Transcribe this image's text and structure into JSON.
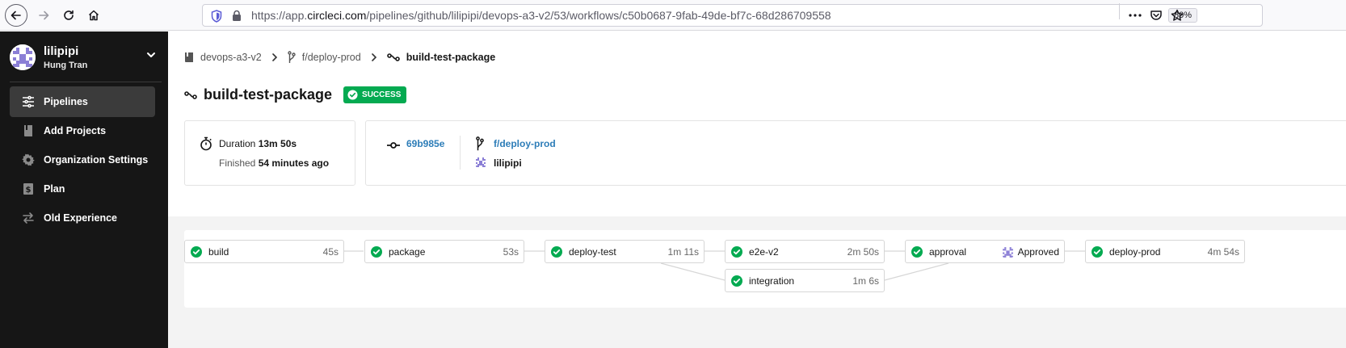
{
  "browser": {
    "url_prefix": "https://app.",
    "url_host": "circleci.com",
    "url_path": "/pipelines/github/lilipipi/devops-a3-v2/53/workflows/c50b0687-9fab-49de-bf7c-68d286709558",
    "zoom": "80%",
    "icons": [
      "back-icon",
      "forward-icon",
      "reload-icon",
      "home-icon",
      "shield-icon",
      "lock-icon",
      "more-icon",
      "pocket-icon",
      "star-icon"
    ]
  },
  "sidebar": {
    "org_name": "lilipipi",
    "user_name": "Hung Tran",
    "items": [
      {
        "label": "Pipelines",
        "icon": "pipelines-icon",
        "active": true
      },
      {
        "label": "Add Projects",
        "icon": "book-icon",
        "active": false
      },
      {
        "label": "Organization Settings",
        "icon": "gear-icon",
        "active": false
      },
      {
        "label": "Plan",
        "icon": "dollar-icon",
        "active": false
      },
      {
        "label": "Old Experience",
        "icon": "switch-icon",
        "active": false
      }
    ]
  },
  "breadcrumb": {
    "project": "devops-a3-v2",
    "branch": "f/deploy-prod",
    "workflow": "build-test-package"
  },
  "header": {
    "title": "build-test-package",
    "status": "SUCCESS",
    "status_color": "#04aa51"
  },
  "summary": {
    "duration_label": "Duration",
    "duration_value": "13m 50s",
    "finished_label": "Finished",
    "finished_value": "54 minutes ago",
    "commit_hash": "69b985e",
    "branch": "f/deploy-prod",
    "author": "lilipipi",
    "link_color": "#2d7db8"
  },
  "jobs": [
    {
      "name": "build",
      "time": "45s"
    },
    {
      "name": "package",
      "time": "53s"
    },
    {
      "name": "deploy-test",
      "time": "1m 11s"
    },
    {
      "name": "e2e-v2",
      "time": "2m 50s"
    },
    {
      "name": "integration",
      "time": "1m 6s"
    },
    {
      "name": "approval",
      "status": "Approved"
    },
    {
      "name": "deploy-prod",
      "time": "4m 54s"
    }
  ]
}
